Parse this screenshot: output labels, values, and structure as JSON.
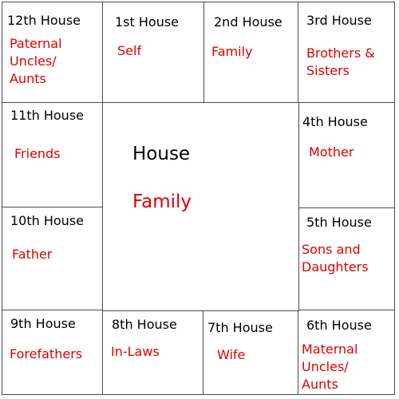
{
  "center": {
    "title": "House",
    "subtitle": "Family"
  },
  "houses": [
    {
      "house": "12th House",
      "role": [
        "Paternal",
        "Uncles/",
        "Aunts"
      ]
    },
    {
      "house": "1st House",
      "role": [
        "Self"
      ]
    },
    {
      "house": "2nd House",
      "role": [
        "Family"
      ]
    },
    {
      "house": "3rd House",
      "role": [
        "Brothers &",
        "Sisters"
      ]
    },
    {
      "house": "11th House",
      "role": [
        "Friends"
      ]
    },
    {
      "house": "4th House",
      "role": [
        "Mother"
      ]
    },
    {
      "house": "10th House",
      "role": [
        "Father"
      ]
    },
    {
      "house": "5th House",
      "role": [
        "Sons and",
        "Daughters"
      ]
    },
    {
      "house": "9th House",
      "role": [
        "Forefathers"
      ]
    },
    {
      "house": "8th House",
      "role": [
        "In-Laws"
      ]
    },
    {
      "house": "7th House",
      "role": [
        "Wife"
      ]
    },
    {
      "house": "6th House",
      "role": [
        "Maternal",
        "Uncles/",
        "Aunts"
      ]
    }
  ],
  "colors": {
    "house_text": "#000000",
    "role_text": "#e00000",
    "border": "#4a4a4a"
  }
}
